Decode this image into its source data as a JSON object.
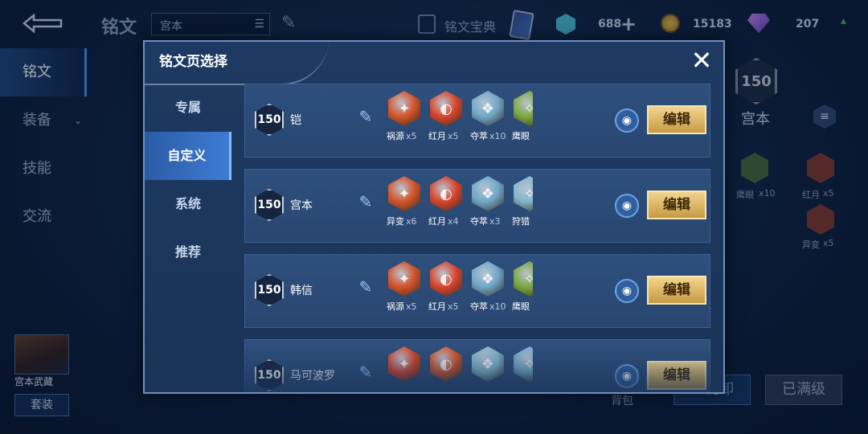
{
  "background": {
    "title": "铭文",
    "selected_page": "宫本",
    "codex_label": "铭文宝典",
    "currency": {
      "gems": "688",
      "coins": "15183",
      "diamonds": "207"
    },
    "nav": [
      {
        "label": "铭文"
      },
      {
        "label": "装备"
      },
      {
        "label": "技能"
      },
      {
        "label": "交流"
      }
    ],
    "hero_name": "宫本武藏",
    "equip_label": "套装",
    "right_panel": {
      "level": "150",
      "name": "宫本",
      "runes": [
        {
          "name": "鹰眼",
          "count": "x10"
        },
        {
          "name": "红月",
          "count": "x5"
        },
        {
          "name": "异变",
          "count": "x5"
        }
      ]
    },
    "bag_label": "背包",
    "unload_label": "一键卸",
    "full_label": "已满级"
  },
  "modal": {
    "title": "铭文页选择",
    "tabs": [
      {
        "label": "专属"
      },
      {
        "label": "自定义"
      },
      {
        "label": "系统"
      },
      {
        "label": "推荐"
      }
    ],
    "active_tab": 1,
    "edit_label": "编辑",
    "pages": [
      {
        "level": "150",
        "name": "铠",
        "runes": [
          {
            "name": "祸源",
            "count": "x5",
            "color": "#d4542a"
          },
          {
            "name": "红月",
            "count": "x5",
            "color": "#d8452b"
          },
          {
            "name": "夺萃",
            "count": "x10",
            "color": "#6fa8c8"
          },
          {
            "name": "鹰眼",
            "count": "",
            "color": "#7ba83e"
          }
        ]
      },
      {
        "level": "150",
        "name": "宫本",
        "runes": [
          {
            "name": "异变",
            "count": "x6",
            "color": "#d4542a"
          },
          {
            "name": "红月",
            "count": "x4",
            "color": "#d8452b"
          },
          {
            "name": "夺萃",
            "count": "x3",
            "color": "#6fa8c8"
          },
          {
            "name": "狩猎",
            "count": "",
            "color": "#7fb6cc"
          }
        ]
      },
      {
        "level": "150",
        "name": "韩信",
        "runes": [
          {
            "name": "祸源",
            "count": "x5",
            "color": "#d4542a"
          },
          {
            "name": "红月",
            "count": "x5",
            "color": "#d8452b"
          },
          {
            "name": "夺萃",
            "count": "x10",
            "color": "#6fa8c8"
          },
          {
            "name": "鹰眼",
            "count": "",
            "color": "#7ba83e"
          }
        ]
      },
      {
        "level": "150",
        "name": "马可波罗",
        "runes": [
          {
            "name": "",
            "count": "",
            "color": "#d8452b"
          },
          {
            "name": "",
            "count": "",
            "color": "#d4542a"
          },
          {
            "name": "",
            "count": "",
            "color": "#7fb6cc"
          },
          {
            "name": "",
            "count": "",
            "color": "#6fa8c8"
          }
        ]
      }
    ]
  }
}
